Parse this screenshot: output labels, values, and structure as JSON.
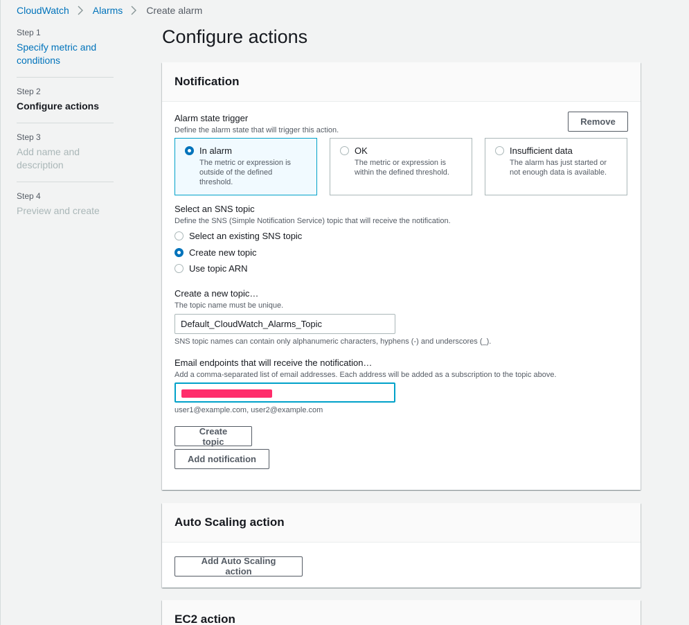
{
  "breadcrumb": {
    "items": [
      "CloudWatch",
      "Alarms"
    ],
    "current": "Create alarm"
  },
  "steps": [
    {
      "num": "Step 1",
      "title": "Specify metric and conditions",
      "state": "link"
    },
    {
      "num": "Step 2",
      "title": "Configure actions",
      "state": "current"
    },
    {
      "num": "Step 3",
      "title": "Add name and description",
      "state": "disabled"
    },
    {
      "num": "Step 4",
      "title": "Preview and create",
      "state": "disabled"
    }
  ],
  "page_title": "Configure actions",
  "notification": {
    "header": "Notification",
    "remove_label": "Remove",
    "trigger": {
      "label": "Alarm state trigger",
      "desc": "Define the alarm state that will trigger this action.",
      "options": [
        {
          "title": "In alarm",
          "desc": "The metric or expression is outside of the defined threshold.",
          "selected": true
        },
        {
          "title": "OK",
          "desc": "The metric or expression is within the defined threshold.",
          "selected": false
        },
        {
          "title": "Insufficient data",
          "desc": "The alarm has just started or not enough data is available.",
          "selected": false
        }
      ]
    },
    "sns": {
      "label": "Select an SNS topic",
      "desc": "Define the SNS (Simple Notification Service) topic that will receive the notification.",
      "options": [
        "Select an existing SNS topic",
        "Create new topic",
        "Use topic ARN"
      ],
      "selected": "Create new topic"
    },
    "new_topic": {
      "label": "Create a new topic…",
      "desc": "The topic name must be unique.",
      "value": "Default_CloudWatch_Alarms_Topic",
      "hint": "SNS topic names can contain only alphanumeric characters, hyphens (-) and underscores (_)."
    },
    "email": {
      "label": "Email endpoints that will receive the notification…",
      "desc": "Add a comma-separated list of email addresses. Each address will be added as a subscription to the topic above.",
      "hint": "user1@example.com, user2@example.com"
    },
    "create_topic_label": "Create topic",
    "add_notification_label": "Add notification"
  },
  "autoscaling": {
    "header": "Auto Scaling action",
    "button": "Add Auto Scaling action"
  },
  "ec2": {
    "header": "EC2 action"
  },
  "colors": {
    "link": "#0073bb",
    "selected_border": "#00a1c9",
    "redaction": "#ff2d6b"
  }
}
